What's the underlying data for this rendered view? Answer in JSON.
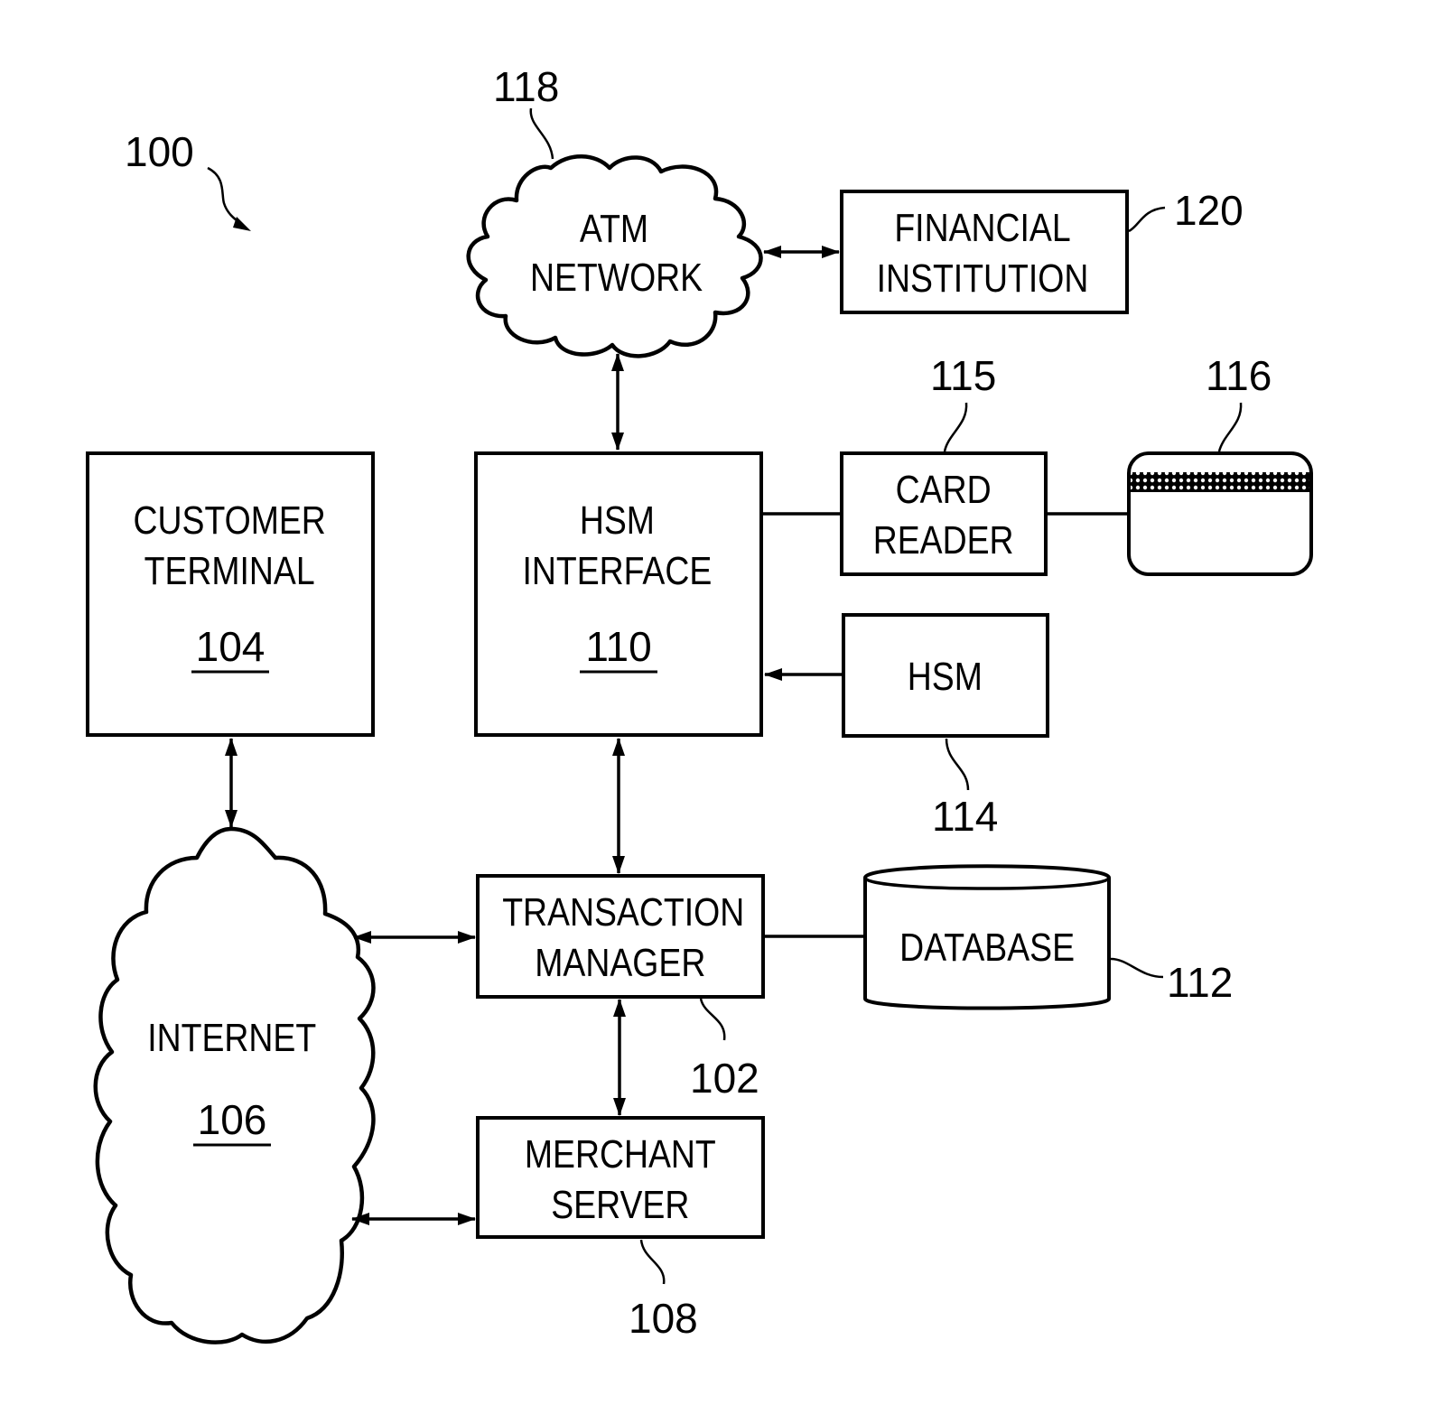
{
  "figure": {
    "ref": "100",
    "colors": {
      "ink": "#000000",
      "background": "#ffffff"
    }
  },
  "nodes": {
    "atm_network": {
      "lines": [
        "ATM",
        "NETWORK"
      ],
      "ref": "118",
      "shape": "cloud"
    },
    "financial_institution": {
      "lines": [
        "FINANCIAL",
        "INSTITUTION"
      ],
      "ref": "120",
      "shape": "box"
    },
    "card_reader": {
      "lines": [
        "CARD",
        "READER"
      ],
      "ref": "115",
      "shape": "box"
    },
    "card": {
      "ref": "116",
      "shape": "magnetic-stripe-card"
    },
    "customer_terminal": {
      "lines": [
        "CUSTOMER",
        "TERMINAL"
      ],
      "ref": "104",
      "shape": "box"
    },
    "hsm_interface": {
      "lines": [
        "HSM",
        "INTERFACE"
      ],
      "ref": "110",
      "shape": "box"
    },
    "hsm": {
      "lines": [
        "HSM"
      ],
      "ref": "114",
      "shape": "box"
    },
    "internet": {
      "lines": [
        "INTERNET"
      ],
      "ref": "106",
      "shape": "cloud"
    },
    "transaction_manager": {
      "lines": [
        "TRANSACTION",
        "MANAGER"
      ],
      "ref": "102",
      "shape": "box"
    },
    "database": {
      "lines": [
        "DATABASE"
      ],
      "ref": "112",
      "shape": "cylinder"
    },
    "merchant_server": {
      "lines": [
        "MERCHANT",
        "SERVER"
      ],
      "ref": "108",
      "shape": "box"
    }
  },
  "edges": [
    {
      "from": "atm_network",
      "to": "financial_institution",
      "arrow": "both"
    },
    {
      "from": "atm_network",
      "to": "hsm_interface",
      "arrow": "both"
    },
    {
      "from": "hsm_interface",
      "to": "card_reader",
      "arrow": "none"
    },
    {
      "from": "card_reader",
      "to": "card",
      "arrow": "none"
    },
    {
      "from": "hsm",
      "to": "hsm_interface",
      "arrow": "forward"
    },
    {
      "from": "customer_terminal",
      "to": "internet",
      "arrow": "both"
    },
    {
      "from": "hsm_interface",
      "to": "transaction_manager",
      "arrow": "both"
    },
    {
      "from": "internet",
      "to": "transaction_manager",
      "arrow": "both"
    },
    {
      "from": "transaction_manager",
      "to": "database",
      "arrow": "none"
    },
    {
      "from": "transaction_manager",
      "to": "merchant_server",
      "arrow": "both"
    },
    {
      "from": "internet",
      "to": "merchant_server",
      "arrow": "both"
    }
  ]
}
